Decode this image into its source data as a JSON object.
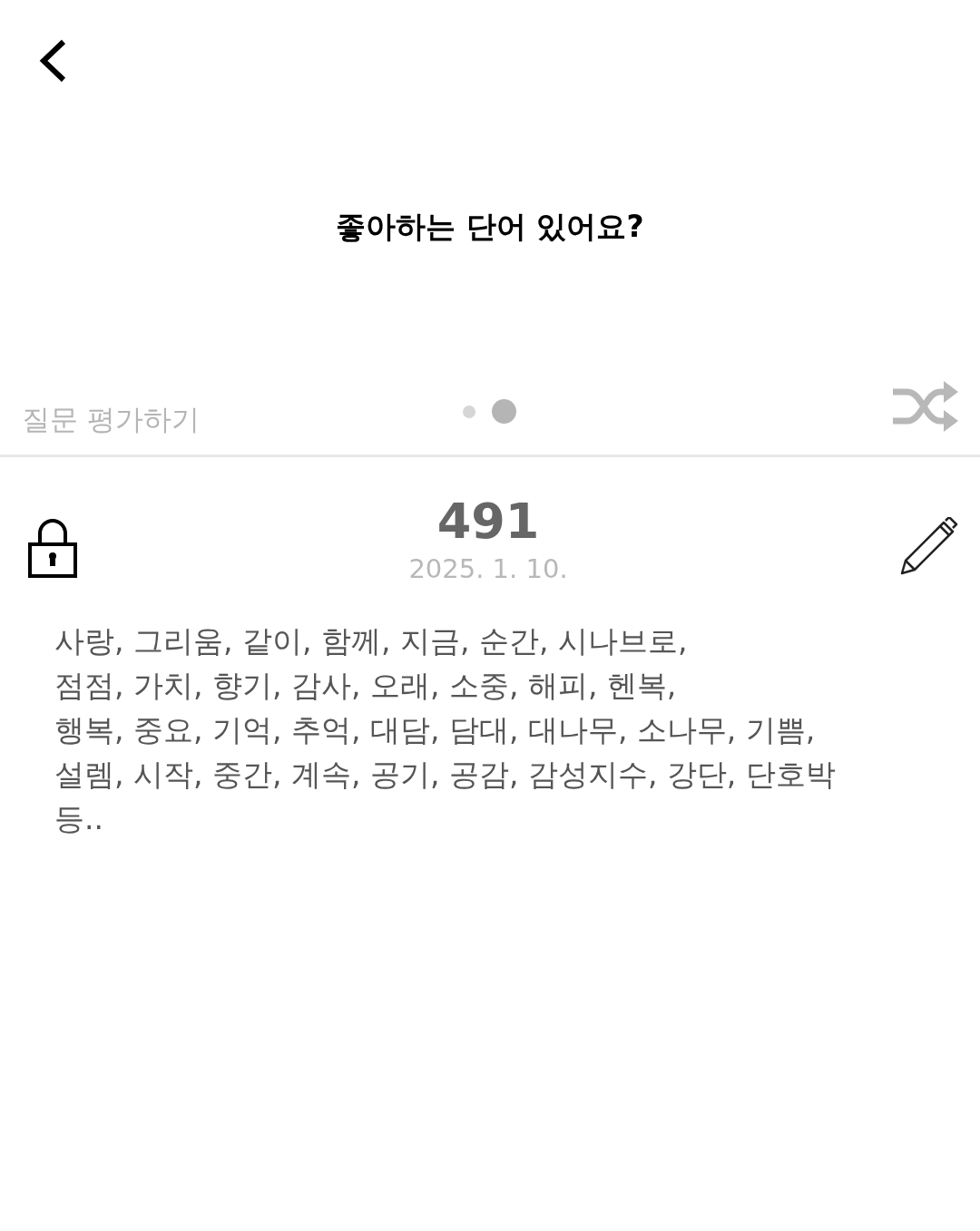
{
  "question": "좋아하는 단어 있어요?",
  "rate_label": "질문 평가하기",
  "pages": [
    {
      "selected": false
    },
    {
      "selected": true
    }
  ],
  "entry": {
    "locked": true,
    "number": "491",
    "date": "2025. 1. 10.",
    "text": "사랑, 그리움, 같이, 함께, 지금, 순간, 시나브로,\n점점, 가치, 향기, 감사, 오래, 소중, 해피, 헨복,\n행복, 중요, 기억, 추억, 대담, 담대, 대나무, 소나무, 기쁨,\n설렘, 시작, 중간, 계속, 공기, 공감, 감성지수, 강단, 단호박\n등.."
  }
}
